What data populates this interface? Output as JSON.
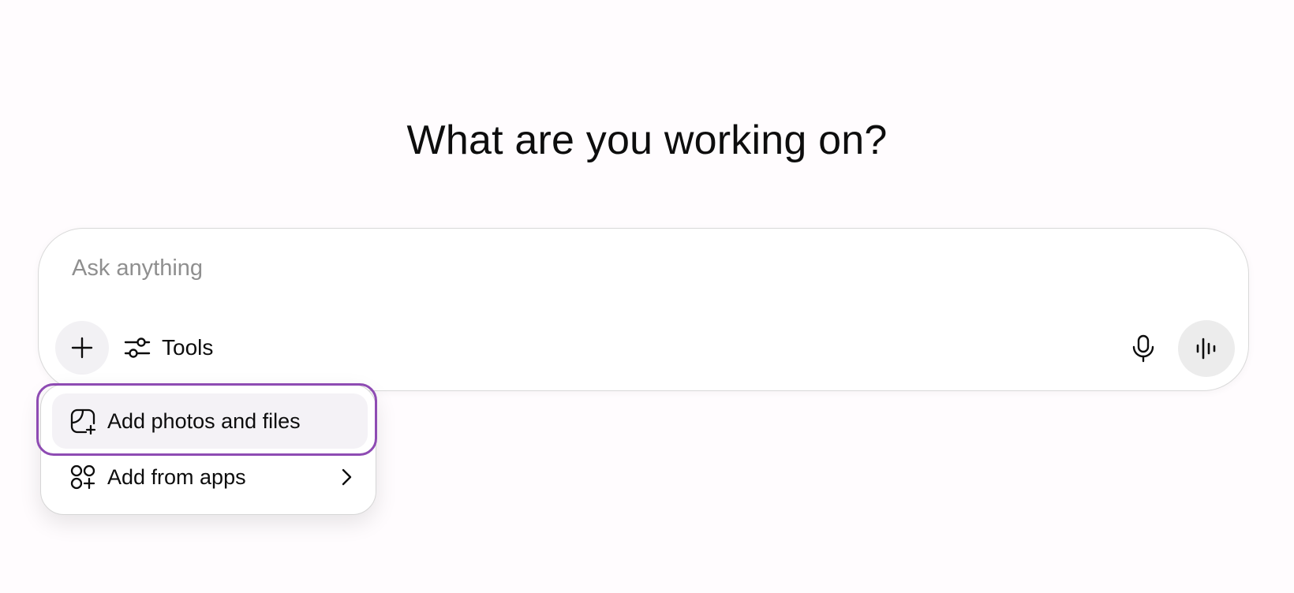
{
  "main": {
    "headline": "What are you working on?"
  },
  "composer": {
    "placeholder": "Ask anything",
    "value": "",
    "tools_label": "Tools",
    "icons": {
      "add": "plus-icon",
      "tools": "sliders-icon",
      "mic": "microphone-icon",
      "voice": "voice-waveform-icon"
    }
  },
  "attach_menu": {
    "items": [
      {
        "label": "Add photos and files",
        "icon": "file-add-icon"
      },
      {
        "label": "Add from apps",
        "icon": "apps-add-icon",
        "submenu_icon": "chevron-right-icon"
      }
    ],
    "highlight_color": "#8e4bb3"
  }
}
